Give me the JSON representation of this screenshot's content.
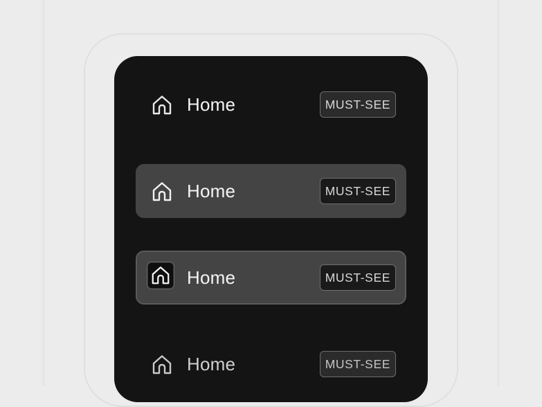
{
  "menu": {
    "items": [
      {
        "state": "default",
        "label": "Home",
        "badge": "MUST-SEE",
        "icon": "home-icon"
      },
      {
        "state": "hover",
        "label": "Home",
        "badge": "MUST-SEE",
        "icon": "home-icon"
      },
      {
        "state": "focus",
        "label": "Home",
        "badge": "MUST-SEE",
        "icon": "home-icon"
      },
      {
        "state": "disabled",
        "label": "Home",
        "badge": "MUST-SEE",
        "icon": "home-icon"
      }
    ]
  },
  "colors": {
    "page_background": "#ececec",
    "menu_background": "#141414",
    "item_highlight": "#444444",
    "text": "#f4f4f4",
    "badge_border": "#6e6e6e"
  }
}
